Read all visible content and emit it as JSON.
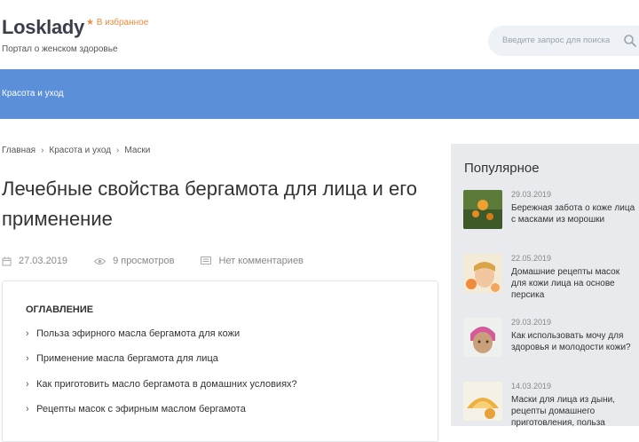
{
  "header": {
    "logo": "Losklady",
    "favorite_label": "★ В избранное",
    "tagline": "Портал о женском здоровье",
    "search_placeholder": "Введите запрос для поиска"
  },
  "nav": {
    "items": [
      {
        "label": "Красота и уход"
      }
    ]
  },
  "breadcrumb": [
    "Главная",
    "Красота и уход",
    "Маски"
  ],
  "article": {
    "title": "Лечебные свойства бергамота для лица и его применение",
    "date": "27.03.2019",
    "views": "9 просмотров",
    "comments": "Нет комментариев"
  },
  "toc": {
    "title": "ОГЛАВЛЕНИЕ",
    "items": [
      "Польза эфирного масла бергамота для кожи",
      "Применение масла бергамота для лица",
      "Как приготовить масло бергамота в домашних условиях?",
      "Рецепты масок с эфирным маслом бергамота"
    ]
  },
  "sidebar": {
    "title": "Популярное",
    "posts": [
      {
        "date": "29.03.2019",
        "title": "Бережная забота о коже лица с масками из морошки"
      },
      {
        "date": "22.05.2019",
        "title": "Домашние рецепты масок для кожи лица на основе персика"
      },
      {
        "date": "29.03.2019",
        "title": "Как использовать мочу для здоровья и молодости кожи?"
      },
      {
        "date": "14.03.2019",
        "title": "Маски для лица из дыни, рецепты домашнего приготовления, польза"
      }
    ]
  },
  "colors": {
    "nav": "#5b8fd9",
    "accent": "#f08a3c",
    "sidebar": "#e8eaed"
  }
}
